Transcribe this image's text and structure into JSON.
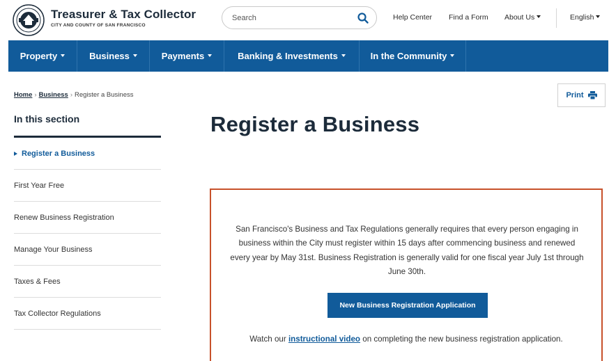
{
  "header": {
    "brand_title": "Treasurer & Tax Collector",
    "brand_subtitle": "CITY AND COUNTY OF SAN FRANCISCO",
    "search_placeholder": "Search",
    "links": {
      "help_center": "Help Center",
      "find_form": "Find a Form",
      "about_us": "About Us",
      "language": "English"
    }
  },
  "nav": {
    "property": "Property",
    "business": "Business",
    "payments": "Payments",
    "banking": "Banking & Investments",
    "community": "In the Community"
  },
  "breadcrumb": {
    "home": "Home",
    "business": "Business",
    "current": "Register a Business"
  },
  "print_label": "Print",
  "sidebar": {
    "title": "In this section",
    "items": [
      {
        "label": "Register a Business"
      },
      {
        "label": "First Year Free"
      },
      {
        "label": "Renew Business Registration"
      },
      {
        "label": "Manage Your Business"
      },
      {
        "label": "Taxes & Fees"
      },
      {
        "label": "Tax Collector Regulations"
      }
    ]
  },
  "main": {
    "title": "Register a Business",
    "info_text": "San Francisco's Business and Tax Regulations generally requires that every person engaging in business within the City must register within 15 days after commencing business and renewed every year by May 31st. Business  Registration is generally valid for one fiscal year July 1st through June 30th.",
    "cta_label": "New Business Registration Application",
    "video_prefix": "Watch our",
    "video_link": "instructional video",
    "video_suffix": "on completing the new business registration application."
  },
  "colors": {
    "nav_blue": "#115b9a",
    "dark_navy": "#1c2b3a",
    "box_border": "#c7512a"
  }
}
